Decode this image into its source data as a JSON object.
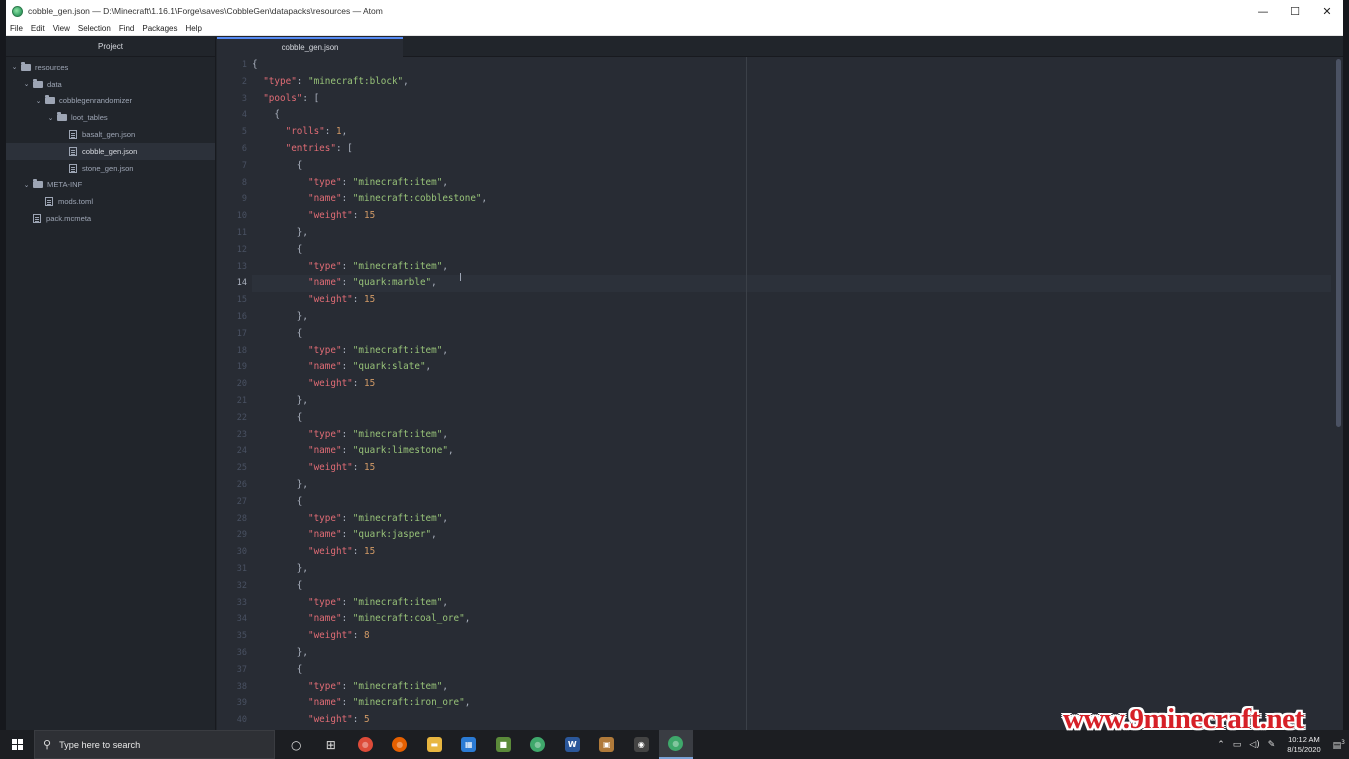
{
  "window": {
    "title": "cobble_gen.json — D:\\Minecraft\\1.16.1\\Forge\\saves\\CobbleGen\\datapacks\\resources — Atom",
    "controls": [
      "—",
      "☐",
      "✕"
    ]
  },
  "menu": [
    "File",
    "Edit",
    "View",
    "Selection",
    "Find",
    "Packages",
    "Help"
  ],
  "tree": {
    "header": "Project",
    "items": [
      {
        "label": "resources",
        "kind": "folder",
        "depth": 0,
        "expanded": true
      },
      {
        "label": "data",
        "kind": "folder",
        "depth": 1,
        "expanded": true
      },
      {
        "label": "cobblegenrandomizer",
        "kind": "folder",
        "depth": 2,
        "expanded": true
      },
      {
        "label": "loot_tables",
        "kind": "folder",
        "depth": 3,
        "expanded": true
      },
      {
        "label": "basalt_gen.json",
        "kind": "file",
        "depth": 4
      },
      {
        "label": "cobble_gen.json",
        "kind": "file",
        "depth": 4,
        "selected": true
      },
      {
        "label": "stone_gen.json",
        "kind": "file",
        "depth": 4
      },
      {
        "label": "META-INF",
        "kind": "folder",
        "depth": 1,
        "expanded": true
      },
      {
        "label": "mods.toml",
        "kind": "file",
        "depth": 2
      },
      {
        "label": "pack.mcmeta",
        "kind": "file",
        "depth": 1
      }
    ]
  },
  "tab": {
    "label": "cobble_gen.json"
  },
  "editor": {
    "current_line": 14,
    "lines": [
      [
        [
          "p",
          "{"
        ]
      ],
      [
        [
          "p",
          "  "
        ],
        [
          "k",
          "\"type\""
        ],
        [
          "p",
          ": "
        ],
        [
          "s",
          "\"minecraft:block\""
        ],
        [
          "p",
          ","
        ]
      ],
      [
        [
          "p",
          "  "
        ],
        [
          "k",
          "\"pools\""
        ],
        [
          "p",
          ": ["
        ]
      ],
      [
        [
          "p",
          "    {"
        ]
      ],
      [
        [
          "p",
          "      "
        ],
        [
          "k",
          "\"rolls\""
        ],
        [
          "p",
          ": "
        ],
        [
          "n",
          "1"
        ],
        [
          "p",
          ","
        ]
      ],
      [
        [
          "p",
          "      "
        ],
        [
          "k",
          "\"entries\""
        ],
        [
          "p",
          ": ["
        ]
      ],
      [
        [
          "p",
          "        {"
        ]
      ],
      [
        [
          "p",
          "          "
        ],
        [
          "k",
          "\"type\""
        ],
        [
          "p",
          ": "
        ],
        [
          "s",
          "\"minecraft:item\""
        ],
        [
          "p",
          ","
        ]
      ],
      [
        [
          "p",
          "          "
        ],
        [
          "k",
          "\"name\""
        ],
        [
          "p",
          ": "
        ],
        [
          "s",
          "\"minecraft:cobblestone\""
        ],
        [
          "p",
          ","
        ]
      ],
      [
        [
          "p",
          "          "
        ],
        [
          "k",
          "\"weight\""
        ],
        [
          "p",
          ": "
        ],
        [
          "n",
          "15"
        ]
      ],
      [
        [
          "p",
          "        },"
        ]
      ],
      [
        [
          "p",
          "        {"
        ]
      ],
      [
        [
          "p",
          "          "
        ],
        [
          "k",
          "\"type\""
        ],
        [
          "p",
          ": "
        ],
        [
          "s",
          "\"minecraft:item\""
        ],
        [
          "p",
          ","
        ]
      ],
      [
        [
          "p",
          "          "
        ],
        [
          "k",
          "\"name\""
        ],
        [
          "p",
          ": "
        ],
        [
          "s",
          "\"quark:marble\""
        ],
        [
          "p",
          ","
        ]
      ],
      [
        [
          "p",
          "          "
        ],
        [
          "k",
          "\"weight\""
        ],
        [
          "p",
          ": "
        ],
        [
          "n",
          "15"
        ]
      ],
      [
        [
          "p",
          "        },"
        ]
      ],
      [
        [
          "p",
          "        {"
        ]
      ],
      [
        [
          "p",
          "          "
        ],
        [
          "k",
          "\"type\""
        ],
        [
          "p",
          ": "
        ],
        [
          "s",
          "\"minecraft:item\""
        ],
        [
          "p",
          ","
        ]
      ],
      [
        [
          "p",
          "          "
        ],
        [
          "k",
          "\"name\""
        ],
        [
          "p",
          ": "
        ],
        [
          "s",
          "\"quark:slate\""
        ],
        [
          "p",
          ","
        ]
      ],
      [
        [
          "p",
          "          "
        ],
        [
          "k",
          "\"weight\""
        ],
        [
          "p",
          ": "
        ],
        [
          "n",
          "15"
        ]
      ],
      [
        [
          "p",
          "        },"
        ]
      ],
      [
        [
          "p",
          "        {"
        ]
      ],
      [
        [
          "p",
          "          "
        ],
        [
          "k",
          "\"type\""
        ],
        [
          "p",
          ": "
        ],
        [
          "s",
          "\"minecraft:item\""
        ],
        [
          "p",
          ","
        ]
      ],
      [
        [
          "p",
          "          "
        ],
        [
          "k",
          "\"name\""
        ],
        [
          "p",
          ": "
        ],
        [
          "s",
          "\"quark:limestone\""
        ],
        [
          "p",
          ","
        ]
      ],
      [
        [
          "p",
          "          "
        ],
        [
          "k",
          "\"weight\""
        ],
        [
          "p",
          ": "
        ],
        [
          "n",
          "15"
        ]
      ],
      [
        [
          "p",
          "        },"
        ]
      ],
      [
        [
          "p",
          "        {"
        ]
      ],
      [
        [
          "p",
          "          "
        ],
        [
          "k",
          "\"type\""
        ],
        [
          "p",
          ": "
        ],
        [
          "s",
          "\"minecraft:item\""
        ],
        [
          "p",
          ","
        ]
      ],
      [
        [
          "p",
          "          "
        ],
        [
          "k",
          "\"name\""
        ],
        [
          "p",
          ": "
        ],
        [
          "s",
          "\"quark:jasper\""
        ],
        [
          "p",
          ","
        ]
      ],
      [
        [
          "p",
          "          "
        ],
        [
          "k",
          "\"weight\""
        ],
        [
          "p",
          ": "
        ],
        [
          "n",
          "15"
        ]
      ],
      [
        [
          "p",
          "        },"
        ]
      ],
      [
        [
          "p",
          "        {"
        ]
      ],
      [
        [
          "p",
          "          "
        ],
        [
          "k",
          "\"type\""
        ],
        [
          "p",
          ": "
        ],
        [
          "s",
          "\"minecraft:item\""
        ],
        [
          "p",
          ","
        ]
      ],
      [
        [
          "p",
          "          "
        ],
        [
          "k",
          "\"name\""
        ],
        [
          "p",
          ": "
        ],
        [
          "s",
          "\"minecraft:coal_ore\""
        ],
        [
          "p",
          ","
        ]
      ],
      [
        [
          "p",
          "          "
        ],
        [
          "k",
          "\"weight\""
        ],
        [
          "p",
          ": "
        ],
        [
          "n",
          "8"
        ]
      ],
      [
        [
          "p",
          "        },"
        ]
      ],
      [
        [
          "p",
          "        {"
        ]
      ],
      [
        [
          "p",
          "          "
        ],
        [
          "k",
          "\"type\""
        ],
        [
          "p",
          ": "
        ],
        [
          "s",
          "\"minecraft:item\""
        ],
        [
          "p",
          ","
        ]
      ],
      [
        [
          "p",
          "          "
        ],
        [
          "k",
          "\"name\""
        ],
        [
          "p",
          ": "
        ],
        [
          "s",
          "\"minecraft:iron_ore\""
        ],
        [
          "p",
          ","
        ]
      ],
      [
        [
          "p",
          "          "
        ],
        [
          "k",
          "\"weight\""
        ],
        [
          "p",
          ": "
        ],
        [
          "n",
          "5"
        ]
      ]
    ]
  },
  "taskbar": {
    "search_placeholder": "Type here to search",
    "apps": [
      {
        "name": "task-view",
        "glyph": "○",
        "color": "transparent"
      },
      {
        "name": "timeline",
        "glyph": "⊞",
        "color": "transparent"
      },
      {
        "name": "chrome",
        "glyph": "●",
        "color": "#dd4b39"
      },
      {
        "name": "firefox",
        "glyph": "●",
        "color": "#e66000"
      },
      {
        "name": "file-explorer",
        "glyph": "▬",
        "color": "#e8b640"
      },
      {
        "name": "store",
        "glyph": "▦",
        "color": "#2b7bd4"
      },
      {
        "name": "minecraft",
        "glyph": "■",
        "color": "#5b8a3a"
      },
      {
        "name": "atom-green",
        "glyph": "●",
        "color": "#3fa86b"
      },
      {
        "name": "word",
        "glyph": "W",
        "color": "#2b579a"
      },
      {
        "name": "crate",
        "glyph": "▣",
        "color": "#b07a3a"
      },
      {
        "name": "obs",
        "glyph": "◉",
        "color": "#444"
      },
      {
        "name": "atom",
        "glyph": "●",
        "color": "#3fa86b",
        "active": true
      }
    ],
    "time": "10:12 AM",
    "date": "8/15/2020",
    "notifications": "3"
  },
  "watermark": "www.9minecraft.net"
}
